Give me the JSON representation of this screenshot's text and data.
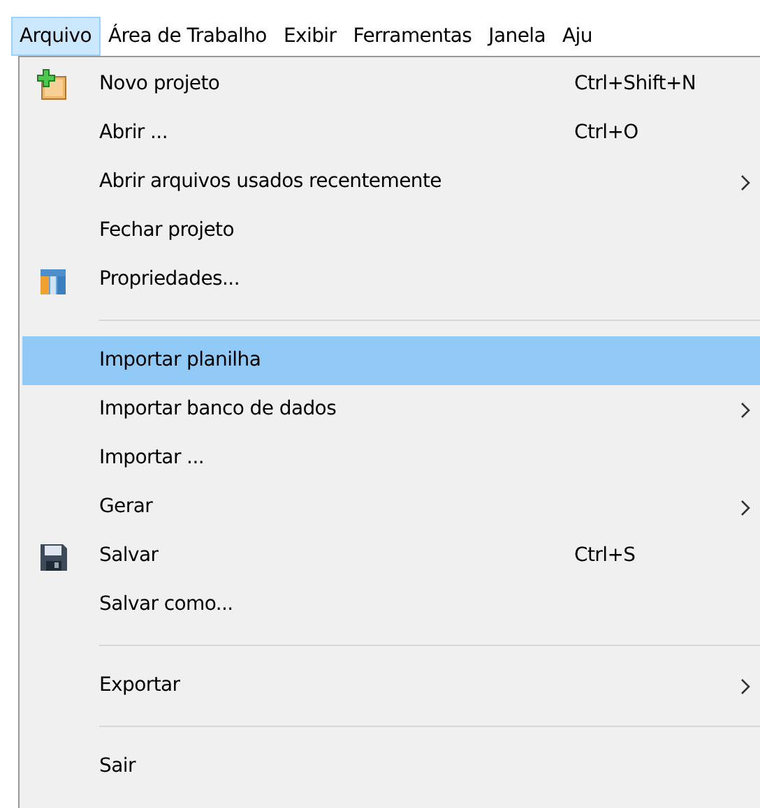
{
  "menubar": [
    {
      "label": "Arquivo",
      "selected": true
    },
    {
      "label": "Área de Trabalho",
      "selected": false
    },
    {
      "label": "Exibir",
      "selected": false
    },
    {
      "label": "Ferramentas",
      "selected": false
    },
    {
      "label": "Janela",
      "selected": false
    },
    {
      "label": "Aju",
      "selected": false
    }
  ],
  "menu": [
    {
      "kind": "item",
      "label": "Novo projeto",
      "shortcut": "Ctrl+Shift+N",
      "selected": false,
      "submenu": false
    },
    {
      "kind": "item",
      "label": "Abrir ...",
      "shortcut": "Ctrl+O",
      "selected": false,
      "submenu": false
    },
    {
      "kind": "item",
      "label": "Abrir arquivos usados recentemente",
      "selected": false,
      "submenu": true
    },
    {
      "kind": "item",
      "label": "Fechar projeto",
      "selected": false,
      "submenu": false
    },
    {
      "kind": "item",
      "label": "Propriedades...",
      "selected": false,
      "submenu": false
    },
    {
      "kind": "separator"
    },
    {
      "kind": "item",
      "label": "Importar planilha",
      "selected": true,
      "submenu": false
    },
    {
      "kind": "item",
      "label": "Importar banco de dados",
      "selected": false,
      "submenu": true
    },
    {
      "kind": "item",
      "label": "Importar ...",
      "selected": false,
      "submenu": false
    },
    {
      "kind": "item",
      "label": "Gerar",
      "selected": false,
      "submenu": true
    },
    {
      "kind": "item",
      "label": "Salvar",
      "shortcut": "Ctrl+S",
      "selected": false,
      "submenu": false
    },
    {
      "kind": "item",
      "label": "Salvar como...",
      "selected": false,
      "submenu": false
    },
    {
      "kind": "separator"
    },
    {
      "kind": "item",
      "label": "Exportar",
      "selected": false,
      "submenu": true
    },
    {
      "kind": "separator"
    },
    {
      "kind": "item",
      "label": "Sair",
      "selected": false,
      "submenu": false
    }
  ]
}
